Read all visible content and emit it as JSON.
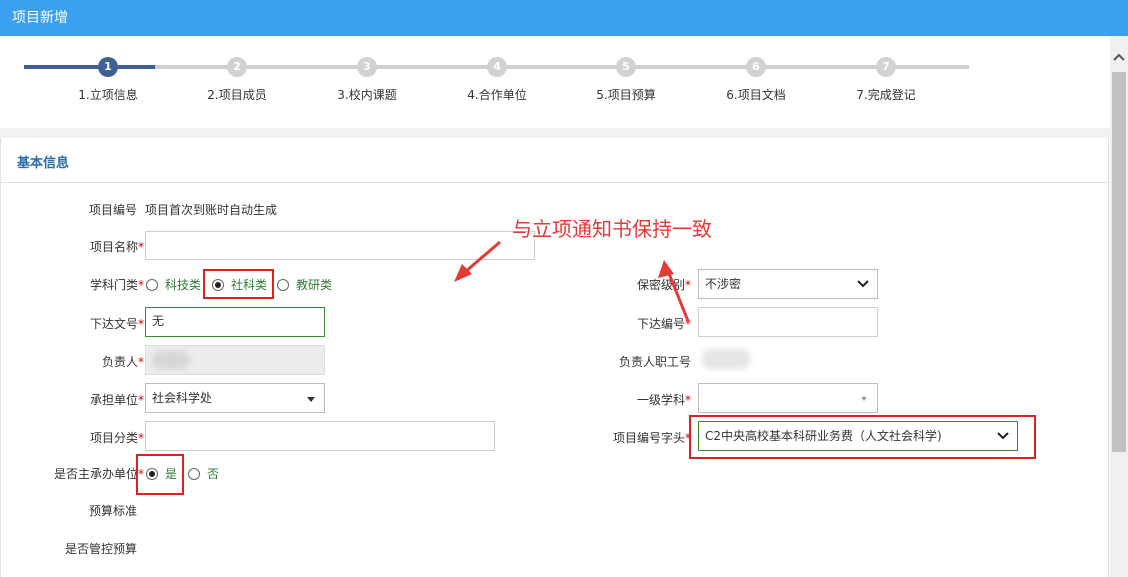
{
  "window": {
    "title": "项目新增"
  },
  "steps": [
    {
      "num": "1",
      "label": "1.立项信息",
      "active": true
    },
    {
      "num": "2",
      "label": "2.项目成员",
      "active": false
    },
    {
      "num": "3",
      "label": "3.校内课题",
      "active": false
    },
    {
      "num": "4",
      "label": "4.合作单位",
      "active": false
    },
    {
      "num": "5",
      "label": "5.项目预算",
      "active": false
    },
    {
      "num": "6",
      "label": "6.项目文档",
      "active": false
    },
    {
      "num": "7",
      "label": "7.完成登记",
      "active": false
    }
  ],
  "section": {
    "title": "基本信息"
  },
  "form": {
    "project_no": {
      "label": "项目编号",
      "value": "项目首次到账时自动生成"
    },
    "project_name": {
      "label": "项目名称",
      "required": "*",
      "value": ""
    },
    "discipline_category": {
      "label": "学科门类",
      "required": "*",
      "options": [
        "科技类",
        "社科类",
        "教研类"
      ],
      "selected": "社科类"
    },
    "confidentiality": {
      "label": "保密级别",
      "required": "*",
      "value": "不涉密"
    },
    "issue_doc_no": {
      "label": "下达文号",
      "required": "*",
      "value": "无"
    },
    "issue_no": {
      "label": "下达编号",
      "required": "*",
      "value": ""
    },
    "leader": {
      "label": "负责人",
      "required": "*"
    },
    "leader_id": {
      "label": "负责人职工号"
    },
    "undertaking_unit": {
      "label": "承担单位",
      "required": "*",
      "value": "社会科学处"
    },
    "primary_discipline": {
      "label": "一级学科",
      "required": "*",
      "value": ""
    },
    "project_class": {
      "label": "项目分类",
      "required": "*",
      "value": ""
    },
    "project_code_prefix": {
      "label": "项目编号字头",
      "required": "*",
      "value": "C2中央高校基本科研业务费（人文社会科学)"
    },
    "main_unit": {
      "label": "是否主承办单位",
      "required": "*",
      "options": [
        "是",
        "否"
      ],
      "selected": "是"
    },
    "budget_standard": {
      "label": "预算标准"
    },
    "budget_control": {
      "label": "是否管控预算"
    }
  },
  "annotation": {
    "text": "与立项通知书保持一致"
  },
  "colors": {
    "titlebar": "#3aa0f0",
    "step_active": "#3f5f95",
    "highlight": "#e02020",
    "annotation": "#e53935"
  }
}
